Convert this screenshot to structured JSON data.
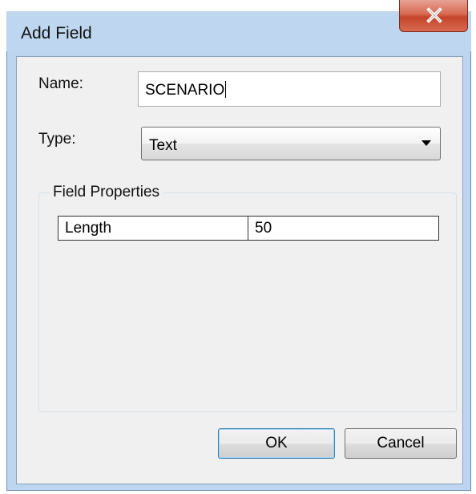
{
  "window": {
    "title": "Add Field"
  },
  "form": {
    "name_label": "Name:",
    "name_value": "SCENARIO",
    "type_label": "Type:",
    "type_value": "Text"
  },
  "field_properties": {
    "legend": "Field Properties",
    "rows": [
      {
        "key": "Length",
        "value": "50"
      }
    ]
  },
  "buttons": {
    "ok_label": "OK",
    "cancel_label": "Cancel"
  },
  "icons": {
    "close": "close-icon",
    "dropdown": "chevron-down-icon"
  },
  "colors": {
    "close_button": "#c4442b",
    "title_bar": "#bed6ef",
    "client_bg": "#f0f0f0"
  }
}
